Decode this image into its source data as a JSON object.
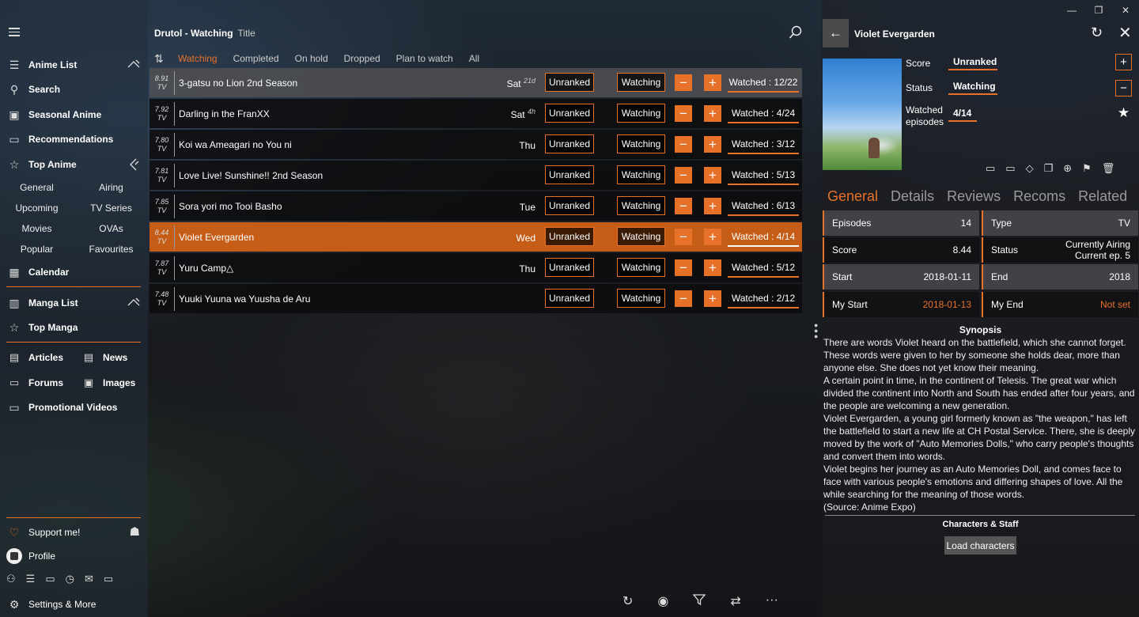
{
  "window": {
    "minimize": "—",
    "restore": "❐",
    "close": "✕"
  },
  "sidebar": {
    "anime_list": "Anime List",
    "search": "Search",
    "seasonal": "Seasonal Anime",
    "recommendations": "Recommendations",
    "top_anime": "Top Anime",
    "top_sub": [
      "General",
      "Airing",
      "Upcoming",
      "TV Series",
      "Movies",
      "OVAs",
      "Popular",
      "Favourites"
    ],
    "calendar": "Calendar",
    "manga_list": "Manga List",
    "top_manga": "Top Manga",
    "articles": "Articles",
    "news": "News",
    "forums": "Forums",
    "images": "Images",
    "promo": "Promotional Videos",
    "support": "Support me!",
    "profile": "Profile",
    "settings": "Settings & More"
  },
  "main": {
    "title": "Drutol - Watching",
    "subtitle": "Title",
    "tabs": [
      "Watching",
      "Completed",
      "On hold",
      "Dropped",
      "Plan to watch",
      "All"
    ],
    "rows": [
      {
        "score": "8.91",
        "type": "TV",
        "name": "3-gatsu no Lion 2nd Season",
        "day": "Sat",
        "sup": "21d",
        "rank": "Unranked",
        "status": "Watching",
        "watched": "Watched : 12/22"
      },
      {
        "score": "7.92",
        "type": "TV",
        "name": "Darling in the FranXX",
        "day": "Sat",
        "sup": "4h",
        "rank": "Unranked",
        "status": "Watching",
        "watched": "Watched : 4/24"
      },
      {
        "score": "7.80",
        "type": "TV",
        "name": "Koi wa Ameagari no You ni",
        "day": "Thu",
        "sup": "",
        "rank": "Unranked",
        "status": "Watching",
        "watched": "Watched : 3/12"
      },
      {
        "score": "7.81",
        "type": "TV",
        "name": "Love Live! Sunshine!! 2nd Season",
        "day": "",
        "sup": "",
        "rank": "Unranked",
        "status": "Watching",
        "watched": "Watched : 5/13"
      },
      {
        "score": "7.85",
        "type": "TV",
        "name": "Sora yori mo Tooi Basho",
        "day": "Tue",
        "sup": "",
        "rank": "Unranked",
        "status": "Watching",
        "watched": "Watched : 6/13"
      },
      {
        "score": "8.44",
        "type": "TV",
        "name": "Violet Evergarden",
        "day": "Wed",
        "sup": "",
        "rank": "Unranked",
        "status": "Watching",
        "watched": "Watched : 4/14"
      },
      {
        "score": "7.87",
        "type": "TV",
        "name": "Yuru Camp△",
        "day": "Thu",
        "sup": "",
        "rank": "Unranked",
        "status": "Watching",
        "watched": "Watched : 5/12"
      },
      {
        "score": "7.48",
        "type": "TV",
        "name": "Yuuki Yuuna wa Yuusha de Aru",
        "day": "",
        "sup": "",
        "rank": "Unranked",
        "status": "Watching",
        "watched": "Watched : 2/12"
      }
    ]
  },
  "detail": {
    "title": "Violet Evergarden",
    "score_label": "Score",
    "score_value": "Unranked",
    "status_label": "Status",
    "status_value": "Watching",
    "watched_label_1": "Watched",
    "watched_label_2": "episodes",
    "watched_value": "4/14",
    "tabs": [
      "General",
      "Details",
      "Reviews",
      "Recoms",
      "Related"
    ],
    "info": {
      "episodes_label": "Episodes",
      "episodes": "14",
      "type_label": "Type",
      "type": "TV",
      "score_label": "Score",
      "score": "8.44",
      "status_label": "Status",
      "status_1": "Currently Airing",
      "status_2": "Current ep. 5",
      "start_label": "Start",
      "start": "2018-01-11",
      "end_label": "End",
      "end": "2018",
      "mystart_label": "My Start",
      "mystart": "2018-01-13",
      "myend_label": "My End",
      "myend": "Not set"
    },
    "synopsis_title": "Synopsis",
    "synopsis": "There are words Violet heard on the battlefield, which she cannot forget. These words were given to her by someone she holds dear, more than anyone else. She does not yet know their meaning.\nA certain point in time, in the continent of Telesis. The great war which divided the continent into North and South has ended after four years, and the people are welcoming a new generation.\nViolet Evergarden, a young girl formerly known as \"the weapon,\" has left the battlefield to start a new life at CH Postal Service. There, she is deeply moved by the work of \"Auto Memories Dolls,\" who carry people's thoughts and convert them into words.\nViolet begins her journey as an Auto Memories Doll, and comes face to face with various people's emotions and differing shapes of love. All the while searching for the meaning of those words.\n(Source: Anime Expo)",
    "chars_title": "Characters & Staff",
    "load_button": "Load characters"
  },
  "colors": {
    "accent": "#e8712a",
    "selected_row": "#c55d16"
  }
}
